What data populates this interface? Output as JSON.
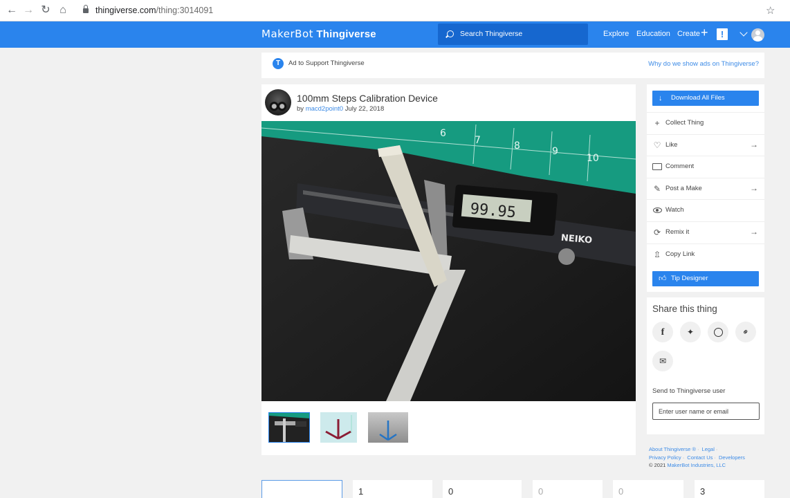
{
  "browser": {
    "url_host": "thingiverse.com",
    "url_path": "/thing:3014091"
  },
  "topnav": {
    "brand_left": "MakerBot",
    "brand_right": "Thingiverse",
    "search_placeholder": "Search Thingiverse",
    "links": [
      "Explore",
      "Education",
      "Create"
    ],
    "alert": "!"
  },
  "ad": {
    "icon_letter": "T",
    "text": "Ad to Support Thingiverse",
    "link": "Why do we show ads on Thingiverse?"
  },
  "thing": {
    "title": "100mm Steps Calibration Device",
    "by": "by",
    "author": "macd2point0",
    "date": "July 22, 2018",
    "caliper_reading": "99.95",
    "thumbnails": [
      "caliper-photo",
      "red-model-render",
      "blue-model-render"
    ]
  },
  "actions": {
    "download": "Download All Files",
    "items": [
      {
        "label": "Collect Thing",
        "icon": "plus-icon",
        "arrow": false
      },
      {
        "label": "Like",
        "icon": "heart-icon",
        "arrow": true
      },
      {
        "label": "Comment",
        "icon": "comment-icon",
        "arrow": false
      },
      {
        "label": "Post a Make",
        "icon": "pencil-icon",
        "arrow": true
      },
      {
        "label": "Watch",
        "icon": "eye-icon",
        "arrow": false
      },
      {
        "label": "Remix it",
        "icon": "remix-icon",
        "arrow": true
      },
      {
        "label": "Copy Link",
        "icon": "share-icon",
        "arrow": false
      }
    ],
    "tip": "Tip Designer"
  },
  "share": {
    "heading": "Share this thing",
    "networks": [
      "facebook",
      "twitter",
      "whatsapp",
      "link",
      "email"
    ],
    "send_label": "Send to Thingiverse user",
    "send_placeholder": "Enter user name or email"
  },
  "footer": {
    "links": [
      "About Thingiverse ®",
      "Legal",
      "Privacy Policy",
      "Contact Us",
      "Developers"
    ],
    "copyright": "© 2021",
    "company": "MakerBot Industries, LLC"
  },
  "stats": [
    "",
    "1",
    "0",
    "0",
    "0",
    "3"
  ],
  "colors": {
    "brand_blue": "#2a84ed",
    "search_bg": "#1667cf",
    "link_blue": "#3d8be6"
  }
}
